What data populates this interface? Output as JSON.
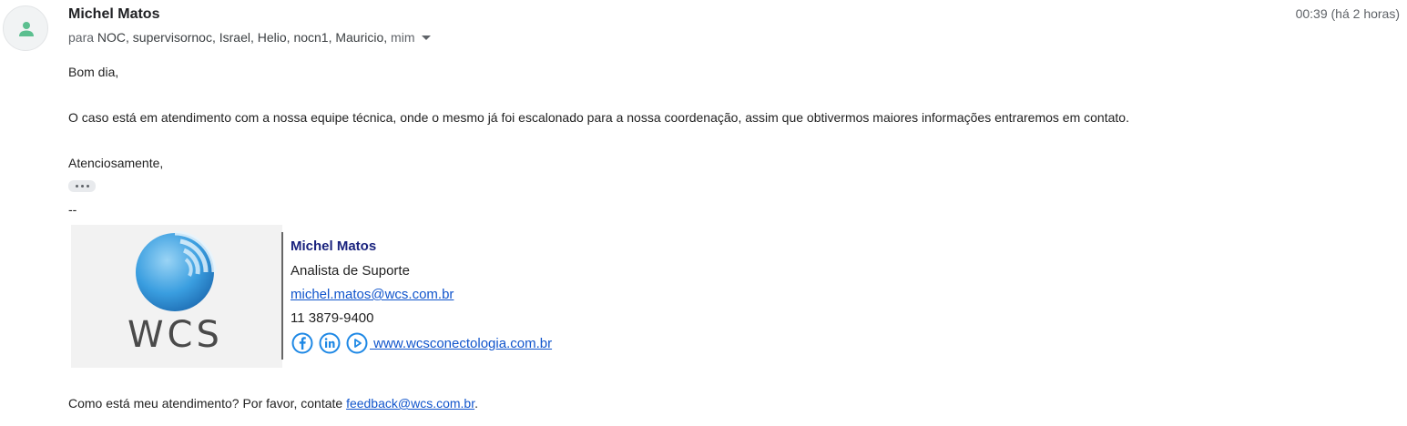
{
  "header": {
    "sender_name": "Michel Matos",
    "to_prefix": "para",
    "recipients": "NOC, supervisornoc, Israel, Helio, nocn1, Mauricio,",
    "self_label": "mim",
    "timestamp": "00:39 (há 2 horas)"
  },
  "body": {
    "greeting": "Bom dia,",
    "paragraph": "O caso está em atendimento com a nossa equipe técnica, onde o mesmo já foi escalonado para a nossa coordenação, assim que obtivermos maiores informações entraremos em contato.",
    "closing": "Atenciosamente,",
    "separator": "--",
    "feedback_text": "Como está meu atendimento? Por favor, contate",
    "feedback_email": "feedback@wcs.com.br",
    "feedback_end": "."
  },
  "signature": {
    "logo_text": "WCS",
    "name": "Michel Matos",
    "role": "Analista de Suporte",
    "email": "michel.matos@wcs.com.br",
    "phone": "11 3879-9400",
    "website": " www.wcsconectologia.com.br",
    "social_icons": [
      "facebook-icon",
      "linkedin-icon",
      "youtube-icon"
    ]
  },
  "colors": {
    "link": "#1155cc",
    "signature_name": "#1a237e",
    "avatar_person": "#5bbf8f",
    "social_icon": "#1e88e5"
  }
}
